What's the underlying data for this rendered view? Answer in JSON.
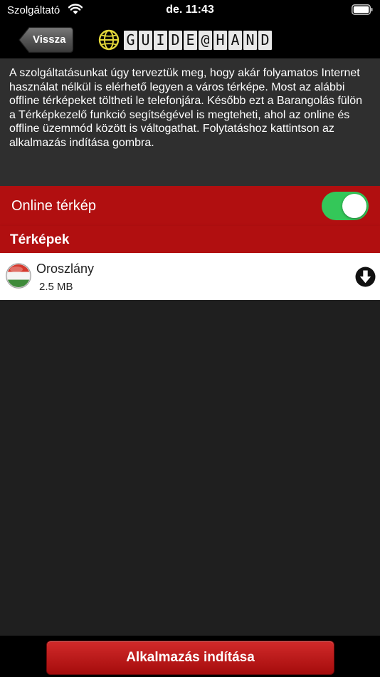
{
  "status_bar": {
    "carrier": "Szolgáltató",
    "time": "de. 11:43"
  },
  "nav": {
    "back_label": "Vissza",
    "logo_text": [
      "G",
      "U",
      "I",
      "D",
      "E",
      "@",
      "H",
      "A",
      "N",
      "D"
    ]
  },
  "intro": {
    "text": "A szolgáltatásunkat úgy terveztük meg, hogy akár folyamatos Internet használat nélkül is elérhető legyen a város térképe. Most az alábbi offline térképeket töltheti le telefonjára. Később ezt a Barangolás fülön a Térképkezelő funkció segítségével is megteheti, ahol az online és offline üzemmód között is váltogathat. Folytatáshoz kattintson az alkalmazás indítása gombra."
  },
  "online_map": {
    "label": "Online térkép",
    "enabled": true
  },
  "maps_section": {
    "title": "Térképek",
    "items": [
      {
        "name": "Oroszlány",
        "size": "2.5 MB",
        "flag": "hungary-flag-icon",
        "action_icon": "download-icon"
      }
    ]
  },
  "footer": {
    "start_label": "Alkalmazás indítása"
  },
  "colors": {
    "accent_red": "#b10f10",
    "toggle_on": "#34c759",
    "background": "#1f1f1f",
    "panel": "#2f2f2f"
  }
}
